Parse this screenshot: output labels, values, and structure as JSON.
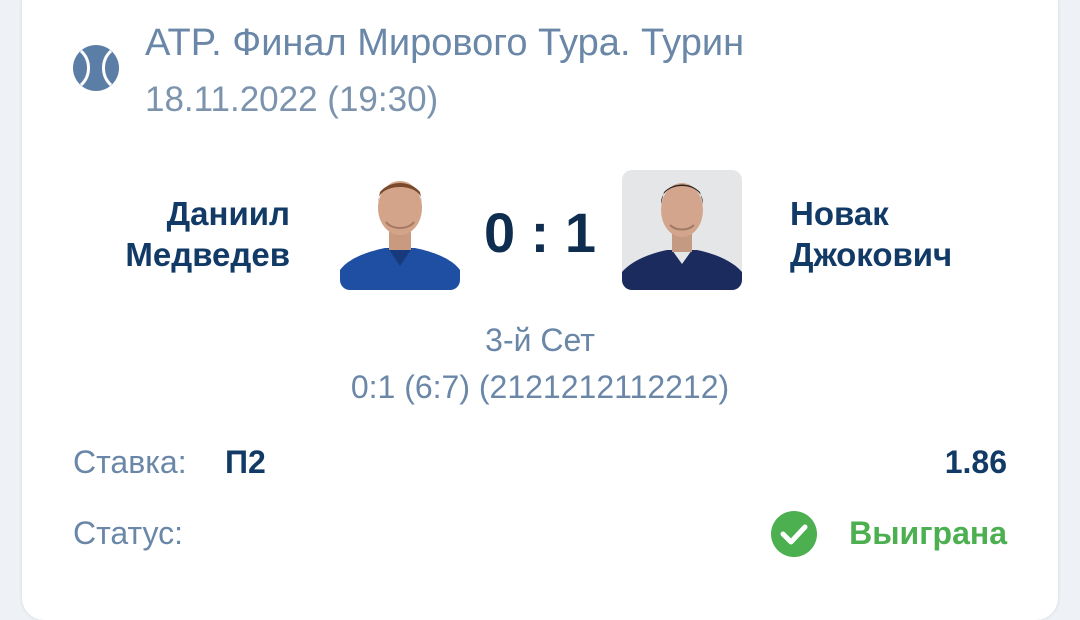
{
  "event": {
    "title": "ATP. Финал Мирового Тура. Турин",
    "datetime": "18.11.2022 (19:30)",
    "sport_icon": "tennis-ball-icon"
  },
  "match": {
    "player1": {
      "name_line1": "Даниил",
      "name_line2": "Медведев"
    },
    "player2": {
      "name_line1": "Новак",
      "name_line2": "Джокович"
    },
    "score": "0 : 1",
    "set_label": "3-й Сет",
    "set_detail": "0:1 (6:7) (2121212112212)"
  },
  "bet": {
    "label": "Ставка:",
    "value": "П2",
    "odds": "1.86"
  },
  "status": {
    "label": "Статус:",
    "value": "Выиграна",
    "icon": "check-circle-icon",
    "color": "#4caf50"
  },
  "colors": {
    "accent": "#5b7ea6",
    "name": "#123a66",
    "muted": "#6a87a8"
  }
}
